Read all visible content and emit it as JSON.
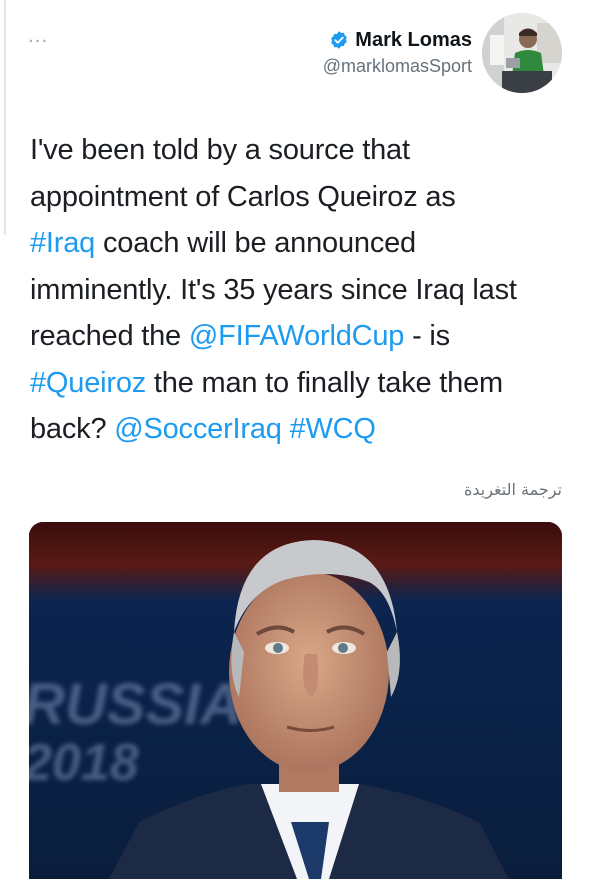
{
  "tweet": {
    "author": {
      "name": "Mark Lomas",
      "handle": "@marklomasSport",
      "verified": true
    },
    "more_label": "...",
    "lines": [
      [
        {
          "t": "I've been told by a source that",
          "link": false
        }
      ],
      [
        {
          "t": "appointment of Carlos Queiroz as",
          "link": false
        }
      ],
      [
        {
          "t": "#Iraq",
          "link": true
        },
        {
          "t": " coach will be announced",
          "link": false
        }
      ],
      [
        {
          "t": "imminently. It's 35 years since Iraq last",
          "link": false
        }
      ],
      [
        {
          "t": "reached the ",
          "link": false
        },
        {
          "t": "@FIFAWorldCup",
          "link": true
        },
        {
          "t": " - is",
          "link": false
        }
      ],
      [
        {
          "t": "#Queiroz",
          "link": true
        },
        {
          "t": " the man to finally take them",
          "link": false
        }
      ],
      [
        {
          "t": "back? ",
          "link": false
        },
        {
          "t": "@SoccerIraq",
          "link": true
        },
        {
          "t": " ",
          "link": false
        },
        {
          "t": "#WCQ",
          "link": true
        }
      ]
    ],
    "translate_label": "ترجمة التغريدة",
    "media": {
      "background_text_1": "RUSSIA",
      "background_text_2": "2018"
    }
  },
  "colors": {
    "link": "#1d9bf0",
    "verified": "#1d9bf0",
    "text": "#1b1f23",
    "secondary": "#66717b"
  },
  "icons": {
    "verified": "verified-badge-icon",
    "more": "more-dots-icon"
  }
}
